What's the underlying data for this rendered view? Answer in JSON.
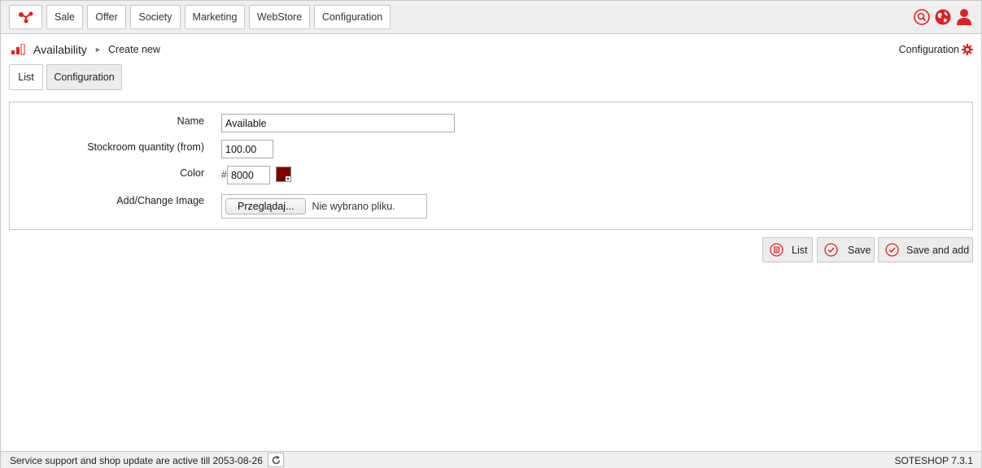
{
  "nav": {
    "items": [
      "Sale",
      "Offer",
      "Society",
      "Marketing",
      "WebStore",
      "Configuration"
    ]
  },
  "breadcrumb": {
    "title": "Availability",
    "separator": "►",
    "current": "Create new",
    "config_link": "Configuration"
  },
  "tabs": [
    "List",
    "Configuration"
  ],
  "form": {
    "name_label": "Name",
    "name_value": "Available",
    "stock_label": "Stockroom quantity (from)",
    "stock_value": "100.00",
    "color_label": "Color",
    "color_hash": "#",
    "color_value": "8000",
    "color_swatch": "#800000",
    "image_label": "Add/Change Image",
    "file_button": "Przeglądaj...",
    "file_status": "Nie wybrano pliku."
  },
  "actions": {
    "list": "List",
    "save": "Save",
    "save_add": "Save and add"
  },
  "footer": {
    "support": "Service support and shop update are active till 2053-08-26",
    "version": "SOTESHOP 7.3.1"
  },
  "colors": {
    "accent": "#e02020",
    "topbar_bg": "#efefef"
  }
}
